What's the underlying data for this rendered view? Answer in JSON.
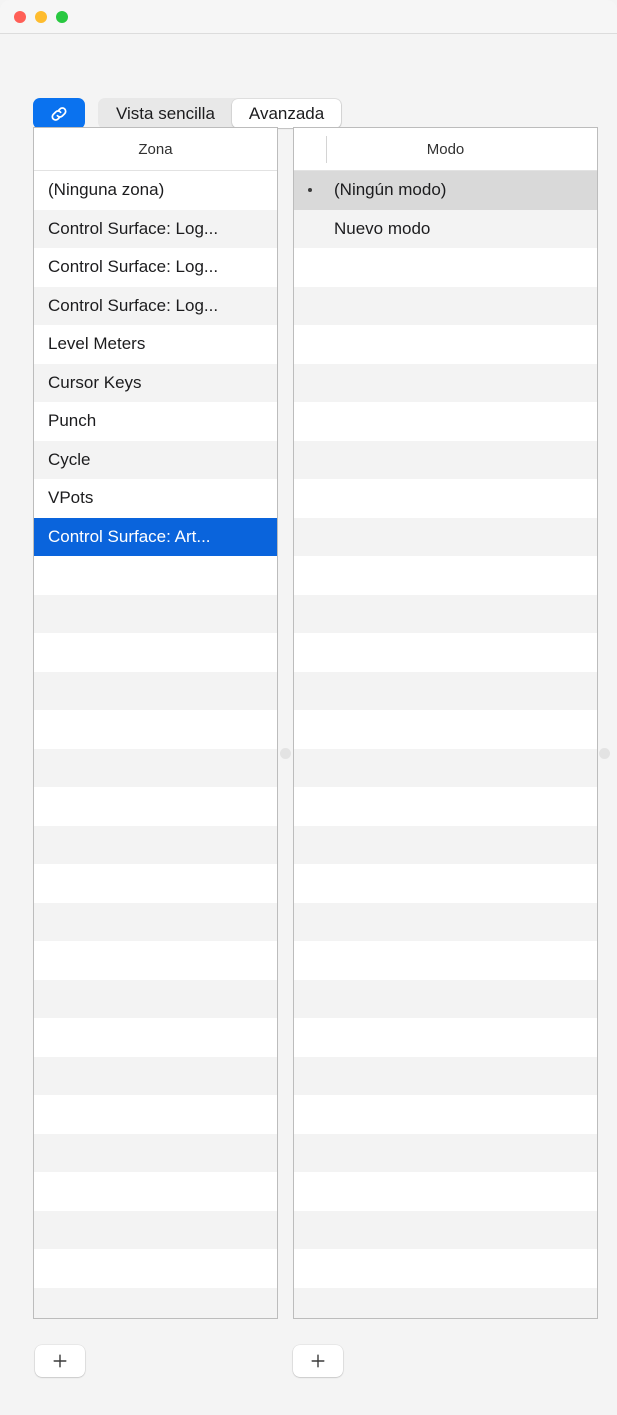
{
  "window": {
    "traffic_lights": [
      "close",
      "minimize",
      "zoom"
    ],
    "colors": {
      "accent_blue": "#0a72ef",
      "selection_blue": "#0a64dc",
      "selection_gray": "#d9d9d9",
      "window_bg": "#f4f4f4",
      "titlebar_bg": "#f6f6f6",
      "row_alt": "#f3f3f3"
    }
  },
  "toolbar": {
    "link_icon": "link-icon",
    "segmented_control": {
      "options": [
        "Vista sencilla",
        "Avanzada"
      ],
      "selected": "Avanzada",
      "simple_label": "Vista sencilla",
      "advanced_label": "Avanzada"
    }
  },
  "zone_list": {
    "header": "Zona",
    "rows": [
      {
        "label": "(Ninguna zona)",
        "selected": false
      },
      {
        "label": "Control Surface: Log...",
        "selected": false
      },
      {
        "label": "Control Surface: Log...",
        "selected": false
      },
      {
        "label": "Control Surface: Log...",
        "selected": false
      },
      {
        "label": "Level Meters",
        "selected": false
      },
      {
        "label": "Cursor Keys",
        "selected": false
      },
      {
        "label": "Punch",
        "selected": false
      },
      {
        "label": "Cycle",
        "selected": false
      },
      {
        "label": "VPots",
        "selected": false
      },
      {
        "label": "Control Surface: Art...",
        "selected": true
      }
    ],
    "empty_row_count": 20,
    "add_button_label": "+"
  },
  "mode_list": {
    "header": "Modo",
    "rows": [
      {
        "label": "(Ningún modo)",
        "bullet": true,
        "selected": true
      },
      {
        "label": "Nuevo modo",
        "bullet": false,
        "selected": false
      }
    ],
    "empty_row_count": 28,
    "add_button_label": "+"
  }
}
